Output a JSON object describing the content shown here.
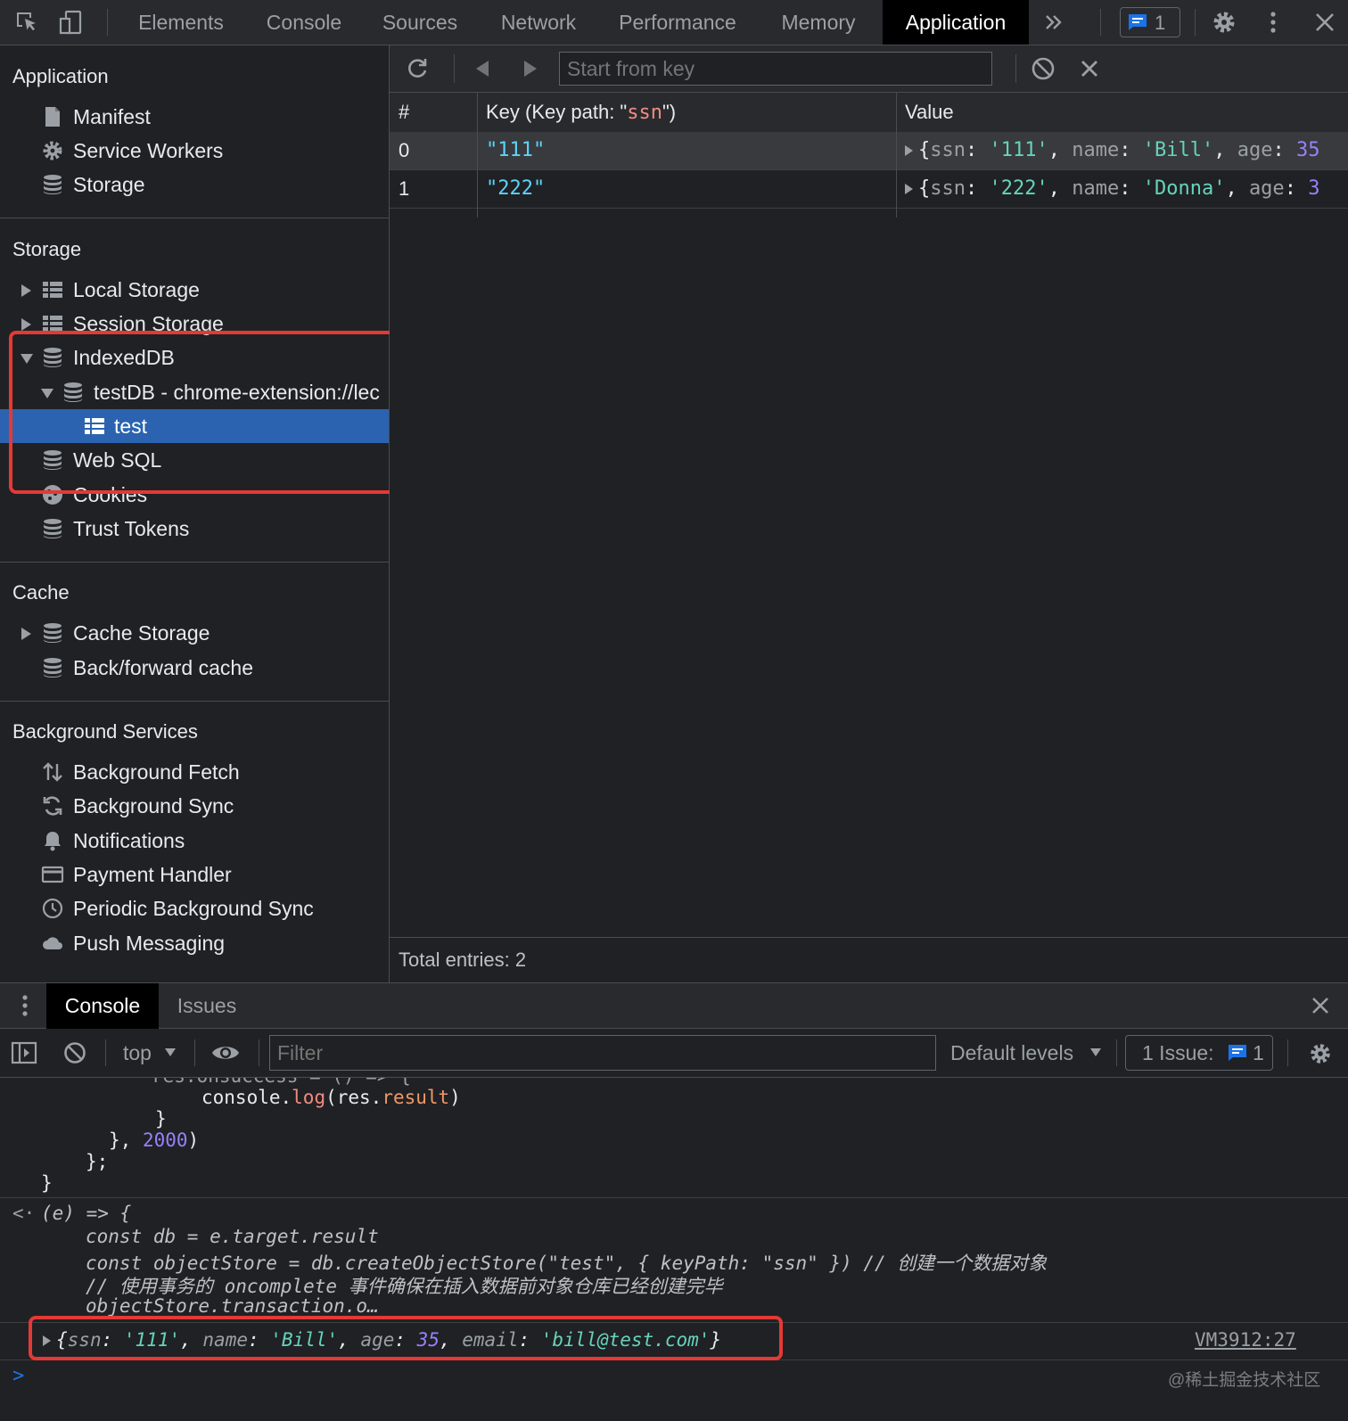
{
  "topbar": {
    "tabs": [
      "Elements",
      "Console",
      "Sources",
      "Network",
      "Performance",
      "Memory",
      "Application"
    ],
    "active_tab": "Application",
    "issues_count": "1"
  },
  "sidebar": {
    "application": {
      "title": "Application",
      "items": [
        "Manifest",
        "Service Workers",
        "Storage"
      ]
    },
    "storage": {
      "title": "Storage",
      "items": [
        "Local Storage",
        "Session Storage",
        "IndexedDB",
        "testDB - chrome-extension://lec",
        "test",
        "Web SQL",
        "Cookies",
        "Trust Tokens"
      ]
    },
    "cache": {
      "title": "Cache",
      "items": [
        "Cache Storage",
        "Back/forward cache"
      ]
    },
    "background": {
      "title": "Background Services",
      "items": [
        "Background Fetch",
        "Background Sync",
        "Notifications",
        "Payment Handler",
        "Periodic Background Sync",
        "Push Messaging"
      ]
    }
  },
  "main": {
    "key_placeholder": "Start from key",
    "columns": {
      "num": "#",
      "key_prefix": "Key (Key path: \"",
      "key_path": "ssn",
      "key_suffix": "\")",
      "value": "Value"
    },
    "rows": [
      {
        "index": "0",
        "key": "\"111\"",
        "ssn": "'111'",
        "name": "'Bill'",
        "age": "35"
      },
      {
        "index": "1",
        "key": "\"222\"",
        "ssn": "'222'",
        "name": "'Donna'",
        "age": "3"
      }
    ],
    "value_labels": {
      "ssn": "ssn",
      "name": "name",
      "age": "age"
    },
    "total_entries": "Total entries: 2"
  },
  "drawer": {
    "tabs": [
      "Console",
      "Issues"
    ],
    "context": "top",
    "filter_placeholder": "Filter",
    "levels": "Default levels",
    "issue_label": "1 Issue:",
    "issue_count": "1"
  },
  "console": {
    "line0": "res.onsuccess = () => {",
    "line1_a": "console.",
    "line1_fn": "log",
    "line1_b": "(res.",
    "line1_prop": "result",
    "line1_c": ")",
    "line2": "}",
    "line3_a": "}, ",
    "line3_num": "2000",
    "line3_b": ")",
    "line4": "};",
    "line5": "}",
    "ret_arrow": "<·",
    "ret1": "(e) => {",
    "ret2": "const db = e.target.result",
    "ret3": "const objectStore = db.createObjectStore(\"test\", { keyPath: \"ssn\" }) // 创建一个数据对象",
    "ret4": "// 使用事务的 oncomplete 事件确保在插入数据前对象仓库已经创建完毕",
    "ret5": "objectStore.transaction.o…",
    "log": {
      "ssn_key": "ssn",
      "ssn_val": "'111'",
      "name_key": "name",
      "name_val": "'Bill'",
      "age_key": "age",
      "age_val": "35",
      "email_key": "email",
      "email_val": "'bill@test.com'"
    },
    "source": "VM3912:27",
    "prompt": ">",
    "watermark": "@稀土掘金技术社区"
  },
  "colors": {
    "selected": "#2b63b0",
    "highlight": "#e53935",
    "accent": "#1a73e8"
  }
}
